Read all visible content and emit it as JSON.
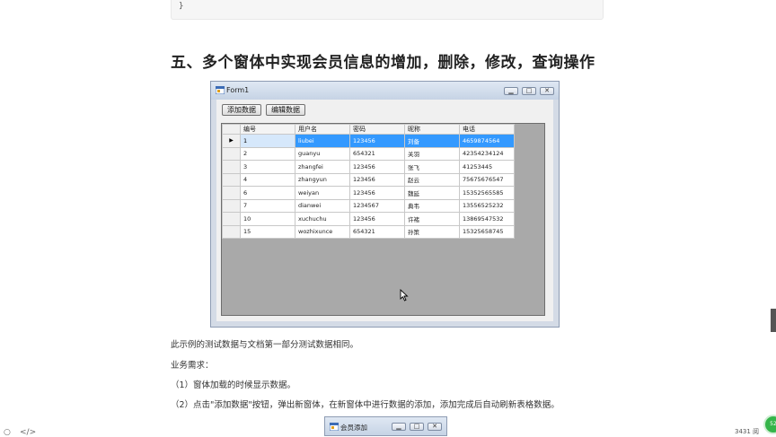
{
  "code_snippet": "}",
  "heading": "五、多个窗体中实现会员信息的增加，删除，修改，查询操作",
  "form1": {
    "title": "Form1",
    "buttons": [
      "添加数据",
      "编辑数据"
    ],
    "columns": [
      "编号",
      "用户名",
      "密码",
      "昵称",
      "电话"
    ],
    "rows": [
      [
        "1",
        "liubei",
        "123456",
        "刘备",
        "4659874564"
      ],
      [
        "2",
        "guanyu",
        "654321",
        "关羽",
        "42354234124"
      ],
      [
        "3",
        "zhangfei",
        "123456",
        "张飞",
        "41253445"
      ],
      [
        "4",
        "zhangyun",
        "123456",
        "赵云",
        "75675676547"
      ],
      [
        "6",
        "weiyan",
        "123456",
        "魏延",
        "15352565585"
      ],
      [
        "7",
        "dianwei",
        "1234567",
        "典韦",
        "13556525232"
      ],
      [
        "10",
        "xuchuchu",
        "123456",
        "许褚",
        "13869547532"
      ],
      [
        "15",
        "wozhixunce",
        "654321",
        "孙策",
        "15325658745"
      ]
    ],
    "selected_row": 0,
    "current_row_marker": "▶"
  },
  "paragraphs": [
    "此示例的测试数据与文档第一部分测试数据相同。",
    "业务需求：",
    "（1）窗体加载的时候显示数据。",
    "（2）点击\"添加数据\"按钮，弹出新窗体，在新窗体中进行数据的添加，添加完成后自动刷新表格数据。"
  ],
  "child_window": {
    "title": "会员添加"
  },
  "bottom_bar": {
    "count": "3431 阅"
  },
  "badge_text": "52",
  "icons": {
    "left": "circle-icon",
    "code": "code-icon"
  },
  "colors": {
    "selection": "#3399ff",
    "grid_background": "#a9a9a9",
    "badge": "#35b54a"
  }
}
